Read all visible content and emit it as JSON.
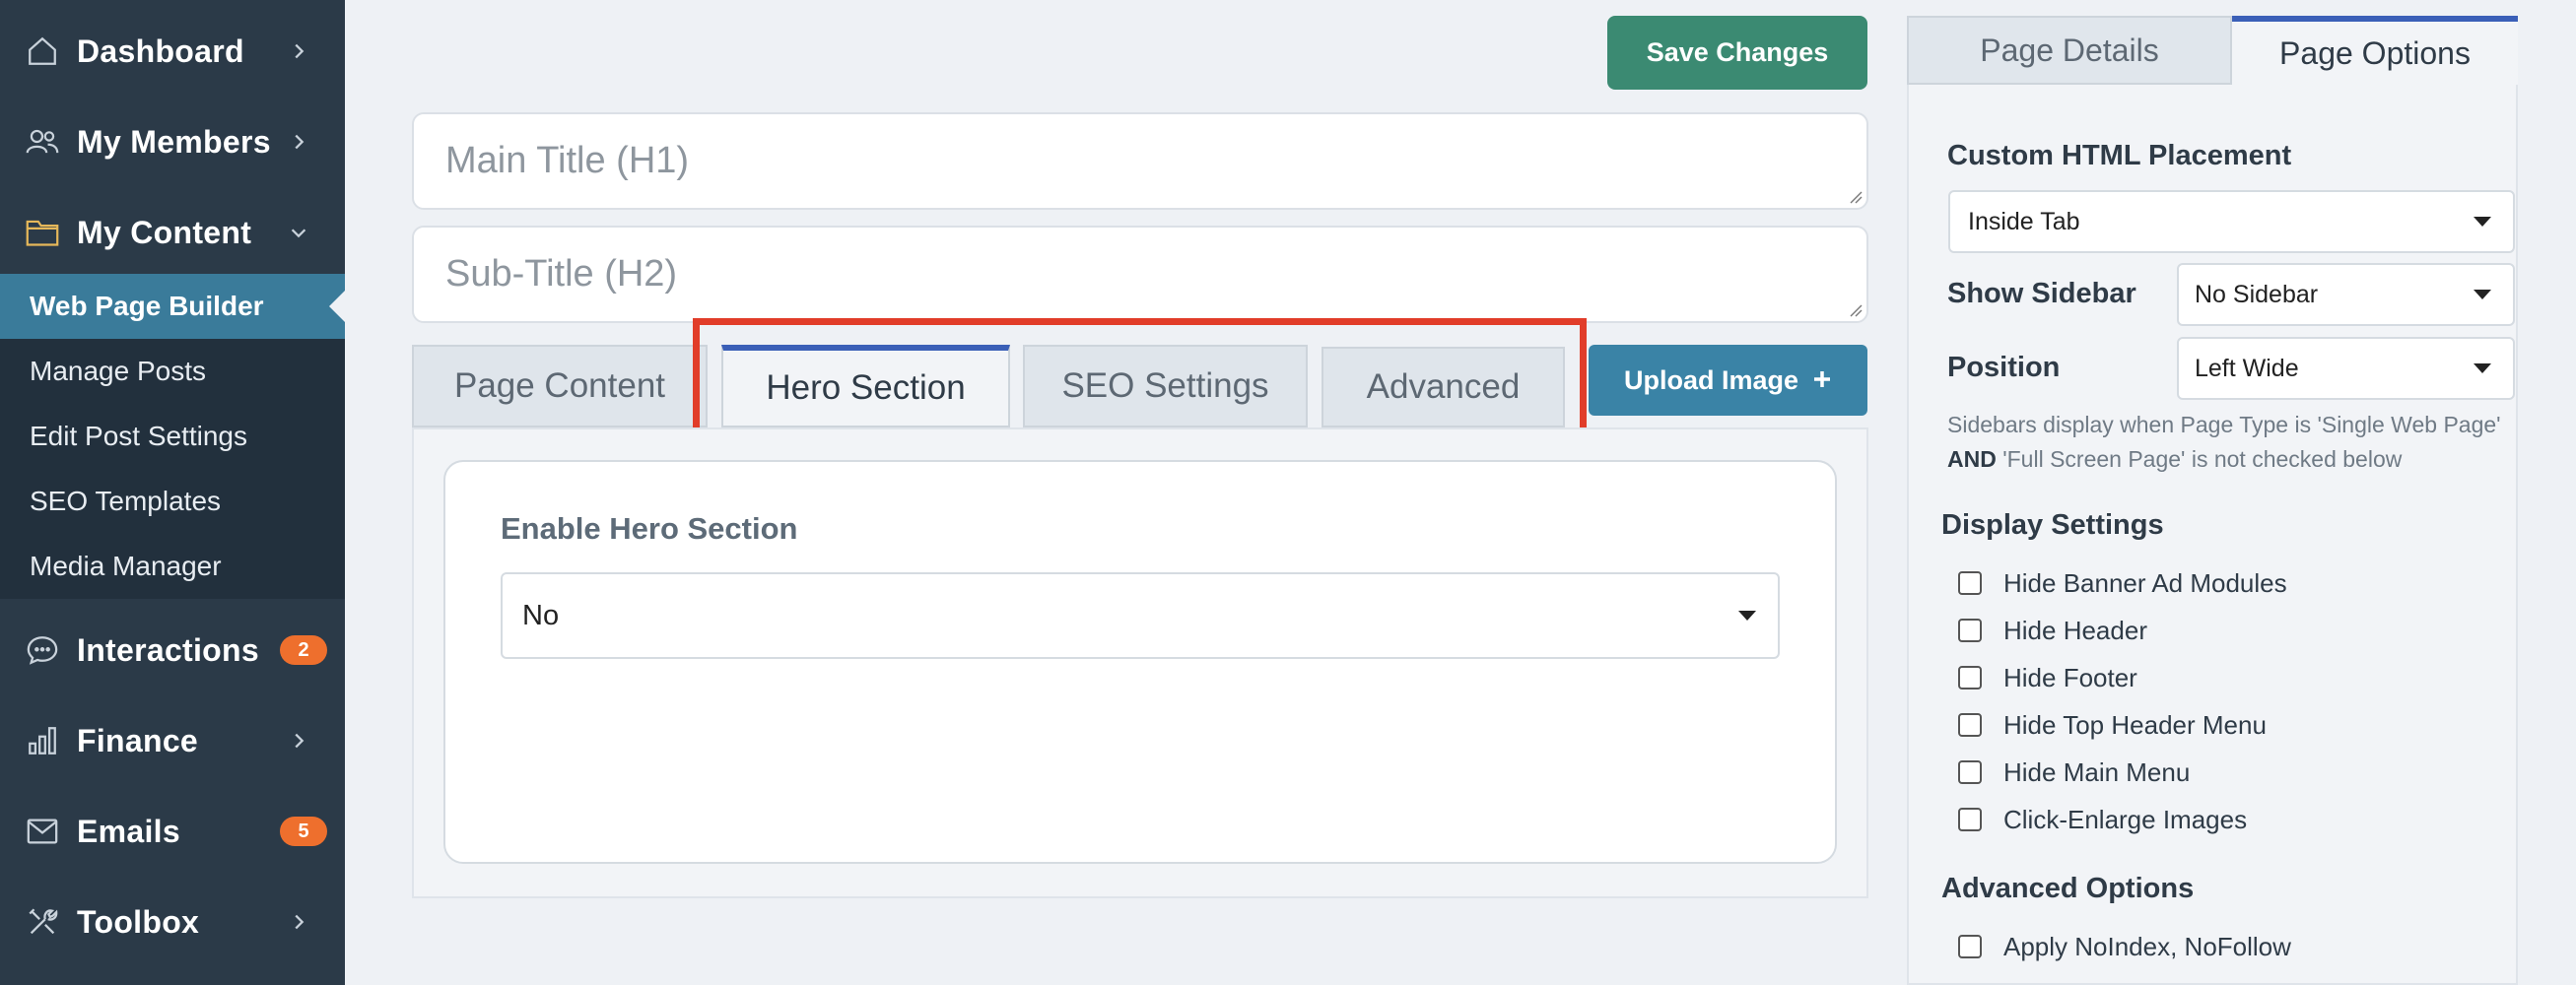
{
  "sidebar": {
    "main_items": [
      {
        "label": "Dashboard",
        "icon": "home-icon",
        "indicator": "chevron-right"
      },
      {
        "label": "My Members",
        "icon": "users-icon",
        "indicator": "chevron-right"
      },
      {
        "label": "My Content",
        "icon": "folder-icon",
        "indicator": "chevron-down"
      },
      {
        "label": "Interactions",
        "icon": "chat-bubble-icon",
        "badge": "2"
      },
      {
        "label": "Finance",
        "icon": "bar-chart-icon",
        "indicator": "chevron-right"
      },
      {
        "label": "Emails",
        "icon": "envelope-icon",
        "badge": "5"
      },
      {
        "label": "Toolbox",
        "icon": "tools-icon",
        "indicator": "chevron-right"
      }
    ],
    "sub_items": [
      {
        "label": "Web Page Builder",
        "active": true
      },
      {
        "label": "Manage Posts"
      },
      {
        "label": "Edit Post Settings"
      },
      {
        "label": "SEO Templates"
      },
      {
        "label": "Media Manager"
      }
    ]
  },
  "toolbar": {
    "save_label": "Save Changes",
    "upload_label": "Upload Image"
  },
  "inputs": {
    "main_title_placeholder": "Main Title (H1)",
    "sub_title_placeholder": "Sub-Title (H2)"
  },
  "tabs": [
    {
      "label": "Page Content"
    },
    {
      "label": "Hero Section",
      "active": true
    },
    {
      "label": "SEO Settings"
    },
    {
      "label": "Advanced"
    }
  ],
  "hero": {
    "field_label": "Enable Hero Section",
    "value": "No"
  },
  "right_panel": {
    "tabs": [
      {
        "label": "Page Details"
      },
      {
        "label": "Page Options",
        "active": true
      }
    ],
    "custom_html_label": "Custom HTML Placement",
    "custom_html_value": "Inside Tab",
    "show_sidebar_label": "Show Sidebar",
    "show_sidebar_value": "No Sidebar",
    "position_label": "Position",
    "position_value": "Left Wide",
    "note_part1": "Sidebars display when Page Type is 'Single Web Page' ",
    "note_bold": "AND",
    "note_part2": " 'Full Screen Page' is not checked below",
    "display_settings_title": "Display Settings",
    "display_settings": [
      "Hide Banner Ad Modules",
      "Hide Header",
      "Hide Footer",
      "Hide Top Header Menu",
      "Hide Main Menu",
      "Click-Enlarge Images"
    ],
    "advanced_title": "Advanced Options",
    "advanced_options": [
      "Apply NoIndex, NoFollow"
    ]
  },
  "colors": {
    "sidebar_bg": "#2b3a48",
    "active_sub": "#3a7b9a",
    "save_green": "#3b8a72",
    "upload_blue": "#3a83a6",
    "highlight_red": "#e13d29",
    "badge_orange": "#ee6f2d",
    "tab_accent": "#3a5fb7"
  }
}
